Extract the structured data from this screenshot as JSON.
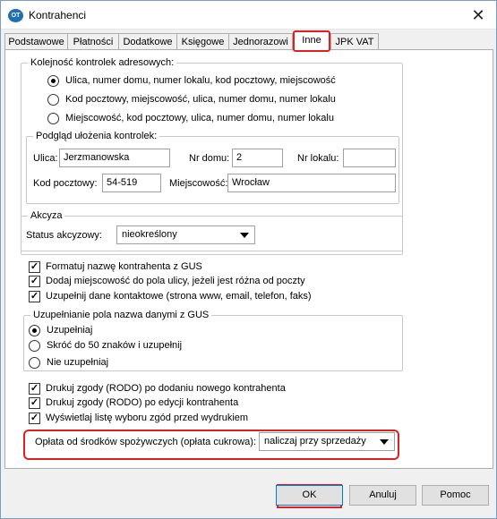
{
  "window": {
    "title": "Kontrahenci",
    "icon_text": "OT",
    "close_label": "✕"
  },
  "tabs": [
    {
      "label": "Podstawowe"
    },
    {
      "label": "Płatności"
    },
    {
      "label": "Dodatkowe"
    },
    {
      "label": "Księgowe"
    },
    {
      "label": "Jednorazowi"
    },
    {
      "label": "Inne"
    },
    {
      "label": "JPK VAT"
    }
  ],
  "active_tab": "Inne",
  "address_order": {
    "legend": "Kolejność kontrolek adresowych:",
    "options": [
      {
        "label": "Ulica, numer domu, numer lokalu, kod pocztowy, miejscowość",
        "selected": true
      },
      {
        "label": "Kod pocztowy, miejscowość, ulica, numer domu, numer lokalu",
        "selected": false
      },
      {
        "label": "Miejscowość, kod pocztowy, ulica, numer domu, numer lokalu",
        "selected": false
      }
    ]
  },
  "preview": {
    "legend": "Podgląd ułożenia kontrolek:",
    "street_label": "Ulica:",
    "street_value": "Jerzmanowska",
    "house_label": "Nr domu:",
    "house_value": "2",
    "apartment_label": "Nr lokalu:",
    "apartment_value": "",
    "postcode_label": "Kod pocztowy:",
    "postcode_value": "54-519",
    "city_label": "Miejscowość:",
    "city_value": "Wrocław"
  },
  "excise": {
    "legend": "Akcyza",
    "status_label": "Status akcyzowy:",
    "status_value": "nieokreślony"
  },
  "gus_checks": [
    {
      "label": "Formatuj nazwę kontrahenta z GUS",
      "checked": true
    },
    {
      "label": "Dodaj miejscowość do pola ulicy, jeżeli jest różna od poczty",
      "checked": true
    },
    {
      "label": "Uzupełnij dane kontaktowe (strona www, email, telefon, faks)",
      "checked": true
    }
  ],
  "gus_name": {
    "legend": "Uzupełnianie pola nazwa danymi z GUS",
    "options": [
      {
        "label": "Uzupełniaj",
        "selected": true
      },
      {
        "label": "Skróć do 50 znaków i uzupełnij",
        "selected": false
      },
      {
        "label": "Nie uzupełniaj",
        "selected": false
      }
    ]
  },
  "rodo_checks": [
    {
      "label": "Drukuj zgody (RODO) po dodaniu nowego kontrahenta",
      "checked": true
    },
    {
      "label": "Drukuj zgody (RODO) po edycji kontrahenta",
      "checked": true
    },
    {
      "label": "Wyświetlaj listę wyboru zgód przed wydrukiem",
      "checked": true
    }
  ],
  "sugar_fee": {
    "label": "Opłata od środków spożywczych (opłata cukrowa):",
    "value": "naliczaj przy sprzedaży"
  },
  "buttons": {
    "ok": "OK",
    "cancel": "Anuluj",
    "help": "Pomoc"
  },
  "colors": {
    "highlight": "#e0201f",
    "window_border": "#7a9cc6",
    "app_icon": "#1f6fb5"
  }
}
